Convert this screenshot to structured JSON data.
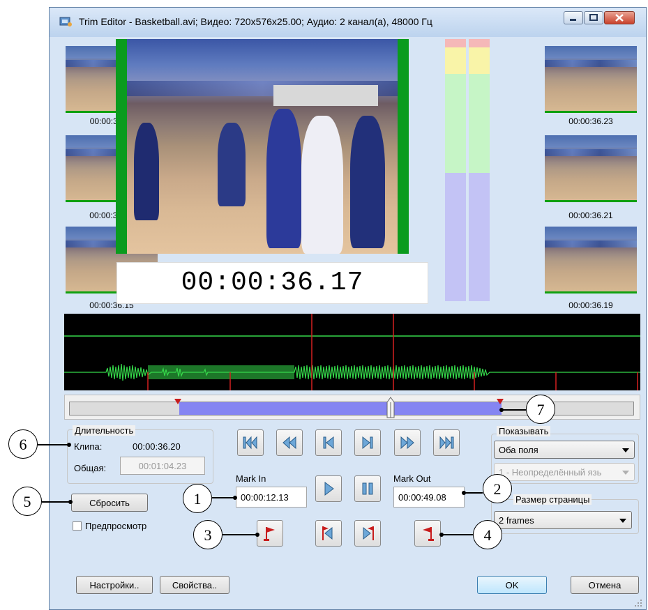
{
  "window": {
    "title": "Trim Editor - Basketball.avi; Видео: 720x576x25.00; Аудио: 2 канал(а), 48000 Гц"
  },
  "thumbnails_left": [
    {
      "timecode": "00:00:36.11"
    },
    {
      "timecode": "00:00:36.13"
    },
    {
      "timecode": "00:00:36.15"
    }
  ],
  "thumbnails_right": [
    {
      "timecode": "00:00:36.23"
    },
    {
      "timecode": "00:00:36.21"
    },
    {
      "timecode": "00:00:36.19"
    }
  ],
  "preview": {
    "current_timecode": "00:00:36.17"
  },
  "duration": {
    "group_label": "Длительность",
    "clip_label": "Клипа:",
    "clip_value": "00:00:36.20",
    "total_label": "Общая:",
    "total_value": "00:01:04.23"
  },
  "buttons": {
    "reset": "Сбросить",
    "settings": "Настройки..",
    "properties": "Свойства..",
    "ok": "OK",
    "cancel": "Отмена"
  },
  "preview_checkbox": {
    "label": "Предпросмотр",
    "checked": false
  },
  "mark_in": {
    "label": "Mark In",
    "value": "00:00:12.13"
  },
  "mark_out": {
    "label": "Mark Out",
    "value": "00:00:49.08"
  },
  "show": {
    "group_label": "Показывать",
    "fields_value": "Оба поля",
    "language_value": "1 - Неопределённый язь"
  },
  "page_size": {
    "group_label": "Размер страницы",
    "value": "2 frames"
  },
  "callouts": [
    "1",
    "2",
    "3",
    "4",
    "5",
    "6",
    "7"
  ],
  "colors": {
    "accent_blue": "#8585f2",
    "transport_blue": "#6da7d8",
    "marker_red": "#c81c1c",
    "waveform_green": "#35d84a",
    "video_border_green": "#0a9b1e"
  }
}
